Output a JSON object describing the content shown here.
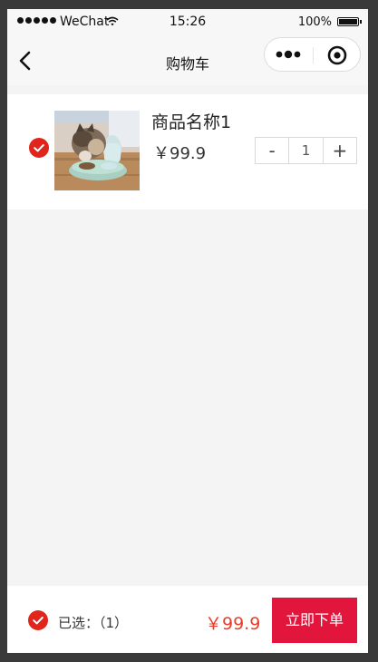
{
  "status_bar": {
    "carrier": "WeChat",
    "time": "15:26",
    "battery": "100%",
    "battery_level": 1.0
  },
  "nav": {
    "title": "购物车"
  },
  "cart": {
    "items": [
      {
        "name": "商品名称1",
        "price": "￥99.9",
        "quantity": "1",
        "minus_label": "-",
        "plus_label": "+",
        "checked": true
      }
    ]
  },
  "footer": {
    "selected_label": "已选：（1）",
    "total": "￥99.9",
    "order_button": "立即下单"
  },
  "colors": {
    "accent_red": "#e1241c",
    "order_button": "#e2163d",
    "price_red": "#ea3c2a"
  }
}
